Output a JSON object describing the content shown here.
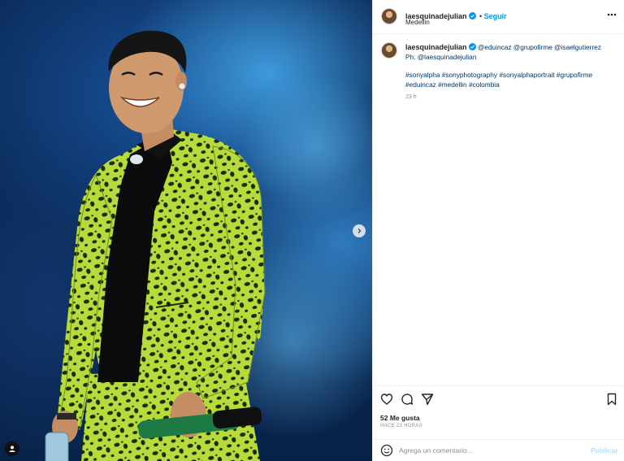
{
  "post": {
    "username": "laesquinadejulian",
    "follow_label": "Seguir",
    "location": "Medellin"
  },
  "caption": {
    "username": "laesquinadejulian",
    "mentions": "@eduincaz @grupofirme @isaelgutierrez",
    "credit": "Ph: @laesquinadejulian",
    "hashtags": "#sonyalpha #sonyphotography #sonyalphaportrait #grupofirme #eduincaz #medellin #colombia",
    "time": "23 h"
  },
  "footer": {
    "likes": "52 Me gusta",
    "ago": "HACE 23 HORAS"
  },
  "comment": {
    "placeholder": "Agrega un comentario...",
    "publish_label": "Publicar"
  },
  "colors": {
    "accent": "#0095f6",
    "publish_disabled": "#b2dffc",
    "jacket": "#b6dc3c"
  },
  "icons": [
    "verified-badge-icon",
    "more-options-icon",
    "heart-icon",
    "comment-icon",
    "share-icon",
    "bookmark-icon",
    "emoji-icon",
    "chevron-right-icon",
    "user-tag-icon"
  ]
}
